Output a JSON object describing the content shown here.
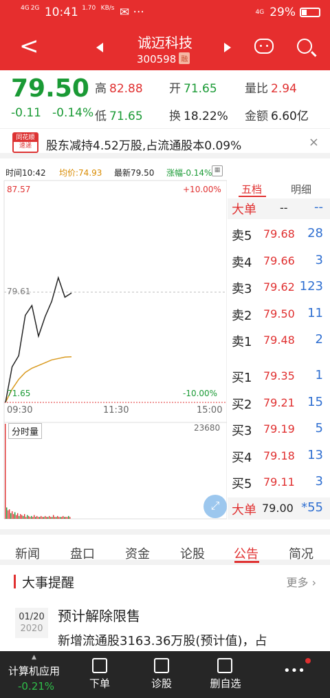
{
  "status": {
    "time": "10:41",
    "speed": "1.70",
    "speed_unit": "KB/s",
    "battery": "29%",
    "net1": "4G",
    "net2": "2G",
    "net3": "4G"
  },
  "stock": {
    "name": "诚迈科技",
    "code": "300598",
    "tag": "融"
  },
  "quote": {
    "price": "79.50",
    "change": "-0.11",
    "pct": "-0.14%",
    "high_label": "高",
    "high": "82.88",
    "open_label": "开",
    "open": "71.65",
    "ratio_label": "量比",
    "ratio": "2.94",
    "low_label": "低",
    "low": "71.65",
    "turn_label": "换",
    "turn": "18.22%",
    "amt_label": "金额",
    "amt": "6.60亿"
  },
  "news": {
    "logo_top": "同花顺",
    "logo_bot": "速递",
    "text": "股东减持4.52万股,占流通股本0.09%",
    "close": "×"
  },
  "chart": {
    "time_label": "时间10:42",
    "avg_label": "均价:74.93",
    "last_label": "最新79.50",
    "chg_label": "涨幅-0.14%",
    "top_price": "87.57",
    "top_pct": "+10.00%",
    "mid_price": "79.61",
    "bot_price": "71.65",
    "bot_pct": "-10.00%",
    "t_start": "09:30",
    "t_mid": "11:30",
    "t_end": "15:00",
    "vol_label": "分时量",
    "vol_max": "23680",
    "calc_icon": "calculator-icon"
  },
  "chart_data": {
    "type": "line",
    "series": [
      {
        "values": [
          71.65,
          74.2,
          75.0,
          77.9,
          78.6,
          76.4,
          77.8,
          78.9,
          80.6,
          79.2,
          79.5
        ]
      },
      {
        "values": [
          71.65,
          72.6,
          73.3,
          73.8,
          74.1,
          74.3,
          74.5,
          74.7,
          74.8,
          74.9,
          74.93
        ]
      }
    ],
    "ylim": [
      71.65,
      87.57
    ]
  },
  "orderbook": {
    "tab1": "五档",
    "tab2": "明细",
    "big_sell_label": "大单",
    "big_sell_p": "--",
    "big_sell_v": "--",
    "asks": [
      {
        "l": "卖5",
        "p": "79.68",
        "v": "28"
      },
      {
        "l": "卖4",
        "p": "79.66",
        "v": "3"
      },
      {
        "l": "卖3",
        "p": "79.62",
        "v": "123"
      },
      {
        "l": "卖2",
        "p": "79.50",
        "v": "11"
      },
      {
        "l": "卖1",
        "p": "79.48",
        "v": "2"
      }
    ],
    "bids": [
      {
        "l": "买1",
        "p": "79.35",
        "v": "1"
      },
      {
        "l": "买2",
        "p": "79.21",
        "v": "15"
      },
      {
        "l": "买3",
        "p": "79.19",
        "v": "5"
      },
      {
        "l": "买4",
        "p": "79.18",
        "v": "13"
      },
      {
        "l": "买5",
        "p": "79.11",
        "v": "3"
      }
    ],
    "big_buy_label": "大单",
    "big_buy_p": "79.00",
    "big_buy_v": "*55"
  },
  "tabs": [
    "新闻",
    "盘口",
    "资金",
    "论股",
    "公告",
    "简况"
  ],
  "event": {
    "title": "大事提醒",
    "more": "更多",
    "date": "01/20",
    "year": "2020",
    "head": "预计解除限售",
    "desc": "新增流通股3163.36万股(预计值)，占"
  },
  "bottom": {
    "sector": "计算机应用",
    "sector_chg": "-0.21%",
    "b1": "下单",
    "b2": "诊股",
    "b3": "删自选",
    "more": "•••"
  }
}
